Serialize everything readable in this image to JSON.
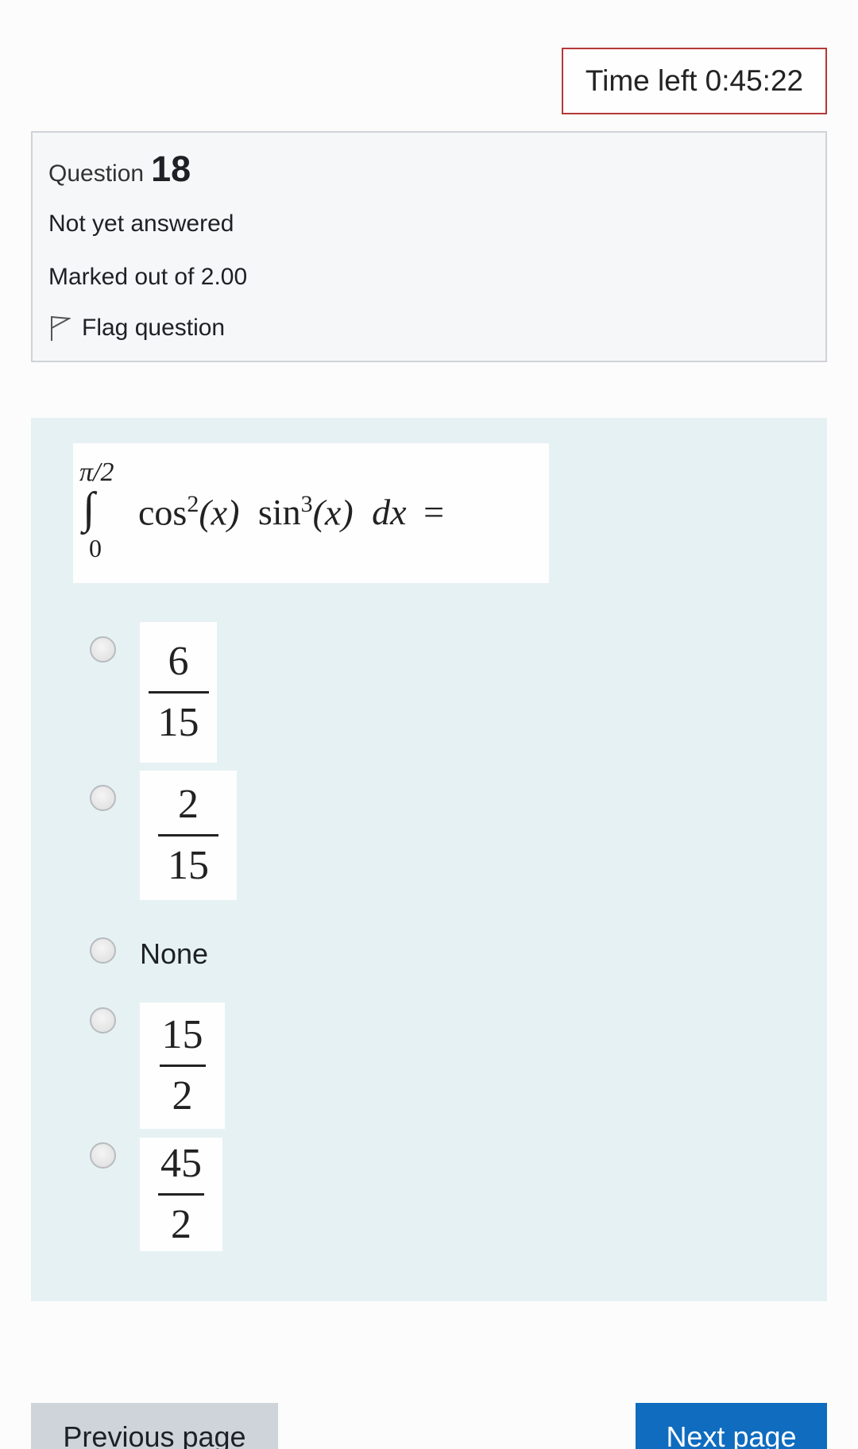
{
  "timer": {
    "label": "Time left 0:45:22"
  },
  "question_info": {
    "question_word": "Question",
    "question_number": "18",
    "status": "Not yet answered",
    "marks": "Marked out of 2.00",
    "flag_label": "Flag question"
  },
  "question": {
    "upper_limit": "π/2",
    "integral_sign": "∫",
    "lower_limit": "0",
    "integrand_cos": "cos",
    "cos_exp": "2",
    "arg1": "(x)",
    "integrand_sin": "sin",
    "sin_exp": "3",
    "arg2": "(x)",
    "differential": "dx",
    "equals": "="
  },
  "options": [
    {
      "type": "fraction",
      "numerator": "6",
      "denominator": "15"
    },
    {
      "type": "fraction",
      "numerator": "2",
      "denominator": "15"
    },
    {
      "type": "text",
      "label": "None"
    },
    {
      "type": "fraction",
      "numerator": "15",
      "denominator": "2"
    },
    {
      "type": "fraction",
      "numerator": "45",
      "denominator": "2"
    }
  ],
  "nav": {
    "previous_label": "Previous page",
    "next_label": "Next page"
  },
  "colors": {
    "timer_border": "#b43838",
    "formulation_bg": "#e6f1f3",
    "next_button": "#0f6cbf",
    "previous_button": "#ced4da"
  }
}
